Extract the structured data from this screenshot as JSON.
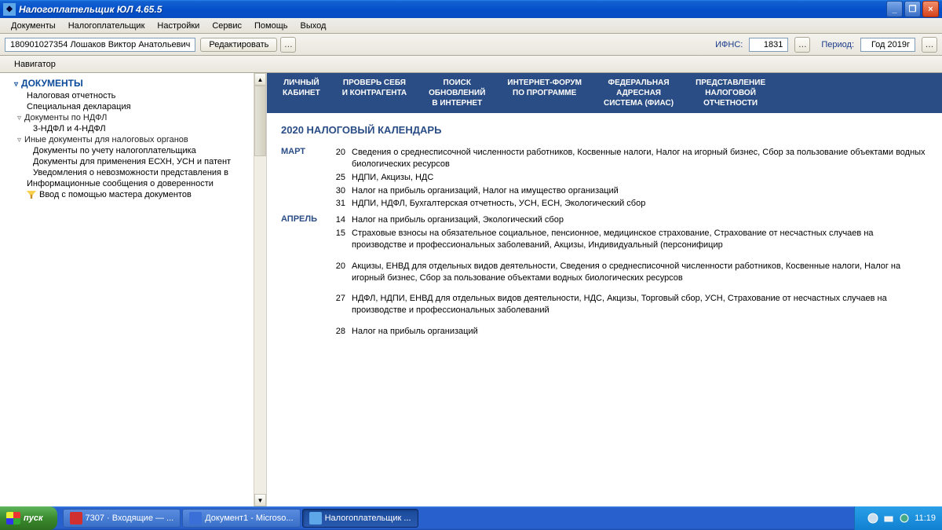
{
  "titlebar": {
    "title": "Налогоплательщик ЮЛ 4.65.5"
  },
  "menu": [
    "Документы",
    "Налогоплательщик",
    "Настройки",
    "Сервис",
    "Помощь",
    "Выход"
  ],
  "toolbar": {
    "payer": "180901027354 Лошаков Виктор Анатольевич",
    "edit_btn": "Редактировать",
    "ifns_label": "ИФНС:",
    "ifns_value": "1831",
    "period_label": "Период:",
    "period_value": "Год 2019г"
  },
  "subbar": {
    "navigator": "Навигатор"
  },
  "tree": {
    "header": "ДОКУМЕНТЫ",
    "items": [
      {
        "label": "Налоговая отчетность",
        "cls": "tree-item"
      },
      {
        "label": "Специальная декларация",
        "cls": "tree-item"
      },
      {
        "label": "Документы по НДФЛ",
        "cls": "tree-sub exp"
      },
      {
        "label": "3-НДФЛ и 4-НДФЛ",
        "cls": "tree-item2"
      },
      {
        "label": "Иные документы для налоговых органов",
        "cls": "tree-sub exp"
      },
      {
        "label": "Документы по учету налогоплательщика",
        "cls": "tree-item2"
      },
      {
        "label": "Документы для применения ЕСХН, УСН и патент",
        "cls": "tree-item2"
      },
      {
        "label": "Уведомления о невозможности представления в",
        "cls": "tree-item2"
      },
      {
        "label": "Информационные сообщения о доверенности",
        "cls": "tree-item"
      },
      {
        "label": "Ввод с помощью мастера документов",
        "cls": "tree-leaf",
        "icon": true
      }
    ]
  },
  "bluenav": [
    "ЛИЧНЫЙ\nКАБИНЕТ",
    "ПРОВЕРЬ СЕБЯ\nИ КОНТРАГЕНТА",
    "ПОИСК\nОБНОВЛЕНИЙ\nВ ИНТЕРНЕТ",
    "ИНТЕРНЕТ-ФОРУМ\nПО ПРОГРАММЕ",
    "ФЕДЕРАЛЬНАЯ\nАДРЕСНАЯ\nСИСТЕМА (ФИАС)",
    "ПРЕДСТАВЛЕНИЕ\nНАЛОГОВОЙ\nОТЧЕТНОСТИ"
  ],
  "calendar": {
    "title": "2020  НАЛОГОВЫЙ КАЛЕНДАРЬ",
    "months": [
      {
        "name": "МАРТ",
        "entries": [
          {
            "day": "20",
            "text": "Сведения о среднесписочной численности работников, Косвенные налоги, Налог на игорный бизнес, Сбор за пользование объектами водных биологических ресурсов"
          },
          {
            "day": "25",
            "text": "НДПИ, Акцизы, НДС"
          },
          {
            "day": "30",
            "text": "Налог на прибыль организаций, Налог на имущество организаций"
          },
          {
            "day": "31",
            "text": "НДПИ, НДФЛ, Бухгалтерская отчетность, УСН, ЕСН, Экологический сбор"
          }
        ]
      },
      {
        "name": "АПРЕЛЬ",
        "entries": [
          {
            "day": "14",
            "text": "Налог на прибыль организаций, Экологический сбор"
          },
          {
            "day": "15",
            "text": "Страховые взносы на обязательное социальное, пенсионное, медицинское страхование, Страхование от несчастных случаев на производстве и профессиональных заболеваний, Акцизы, Индивидуальный (персонифицир"
          },
          {
            "day": "",
            "text": ""
          },
          {
            "day": "20",
            "text": "Акцизы, ЕНВД для отдельных видов деятельности, Сведения о среднесписочной численности работников, Косвенные налоги, Налог на игорный бизнес, Сбор за пользование объектами водных биологических ресурсов"
          },
          {
            "day": "",
            "text": ""
          },
          {
            "day": "27",
            "text": "НДФЛ, НДПИ, ЕНВД для отдельных видов деятельности, НДС, Акцизы, Торговый сбор, УСН, Страхование от несчастных случаев на производстве и профессиональных заболеваний"
          },
          {
            "day": "",
            "text": ""
          },
          {
            "day": "28",
            "text": "Налог на прибыль организаций"
          }
        ]
      }
    ]
  },
  "taskbar": {
    "start": "пуск",
    "items": [
      {
        "label": "7307 · Входящие — ...",
        "color": "#d03030"
      },
      {
        "label": "Документ1 - Microso...",
        "color": "#3a6fd8"
      },
      {
        "label": "Налогоплательщик ...",
        "color": "#5da7e8",
        "active": true
      }
    ],
    "clock": "11:19"
  }
}
